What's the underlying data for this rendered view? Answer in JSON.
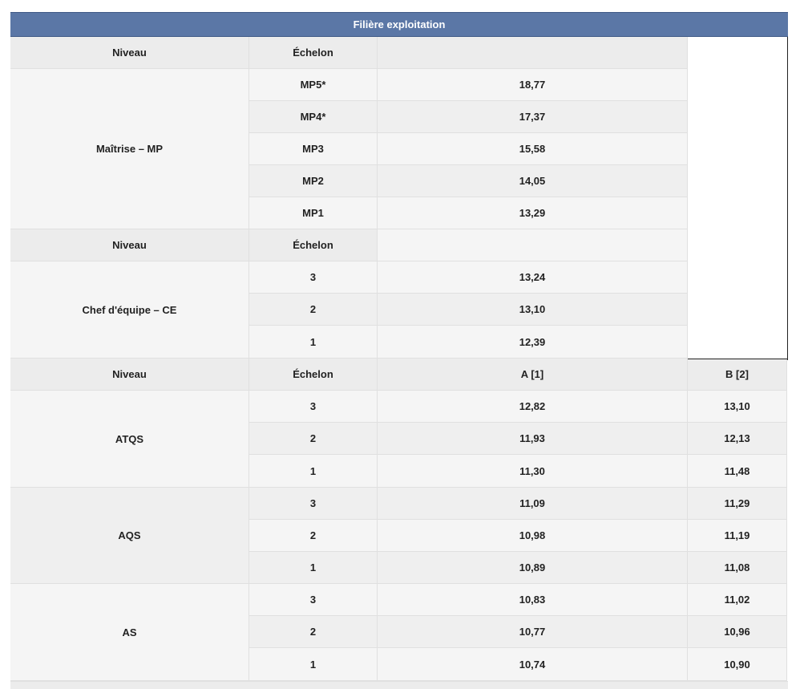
{
  "table": {
    "title": "Filière exploitation",
    "headers": {
      "niveau": "Niveau",
      "echelon": "Échelon",
      "a": "A [1]",
      "b": "B [2]"
    },
    "groups": [
      {
        "niveau": "Maîtrise – MP",
        "rows": [
          {
            "echelon": "MP5*",
            "a": "18,77"
          },
          {
            "echelon": "MP4*",
            "a": "17,37"
          },
          {
            "echelon": "MP3",
            "a": "15,58"
          },
          {
            "echelon": "MP2",
            "a": "14,05"
          },
          {
            "echelon": "MP1",
            "a": "13,29"
          }
        ]
      },
      {
        "niveau": "Chef d'équipe – CE",
        "rows": [
          {
            "echelon": "3",
            "a": "13,24"
          },
          {
            "echelon": "2",
            "a": "13,10"
          },
          {
            "echelon": "1",
            "a": "12,39"
          }
        ]
      },
      {
        "niveau": "ATQS",
        "rows": [
          {
            "echelon": "3",
            "a": "12,82",
            "b": "13,10"
          },
          {
            "echelon": "2",
            "a": "11,93",
            "b": "12,13"
          },
          {
            "echelon": "1",
            "a": "11,30",
            "b": "11,48"
          }
        ]
      },
      {
        "niveau": "AQS",
        "rows": [
          {
            "echelon": "3",
            "a": "11,09",
            "b": "11,29"
          },
          {
            "echelon": "2",
            "a": "10,98",
            "b": "11,19"
          },
          {
            "echelon": "1",
            "a": "10,89",
            "b": "11,08"
          }
        ]
      },
      {
        "niveau": "AS",
        "rows": [
          {
            "echelon": "3",
            "a": "10,83",
            "b": "11,02"
          },
          {
            "echelon": "2",
            "a": "10,77",
            "b": "10,96"
          },
          {
            "echelon": "1",
            "a": "10,74",
            "b": "10,90"
          }
        ]
      }
    ]
  }
}
